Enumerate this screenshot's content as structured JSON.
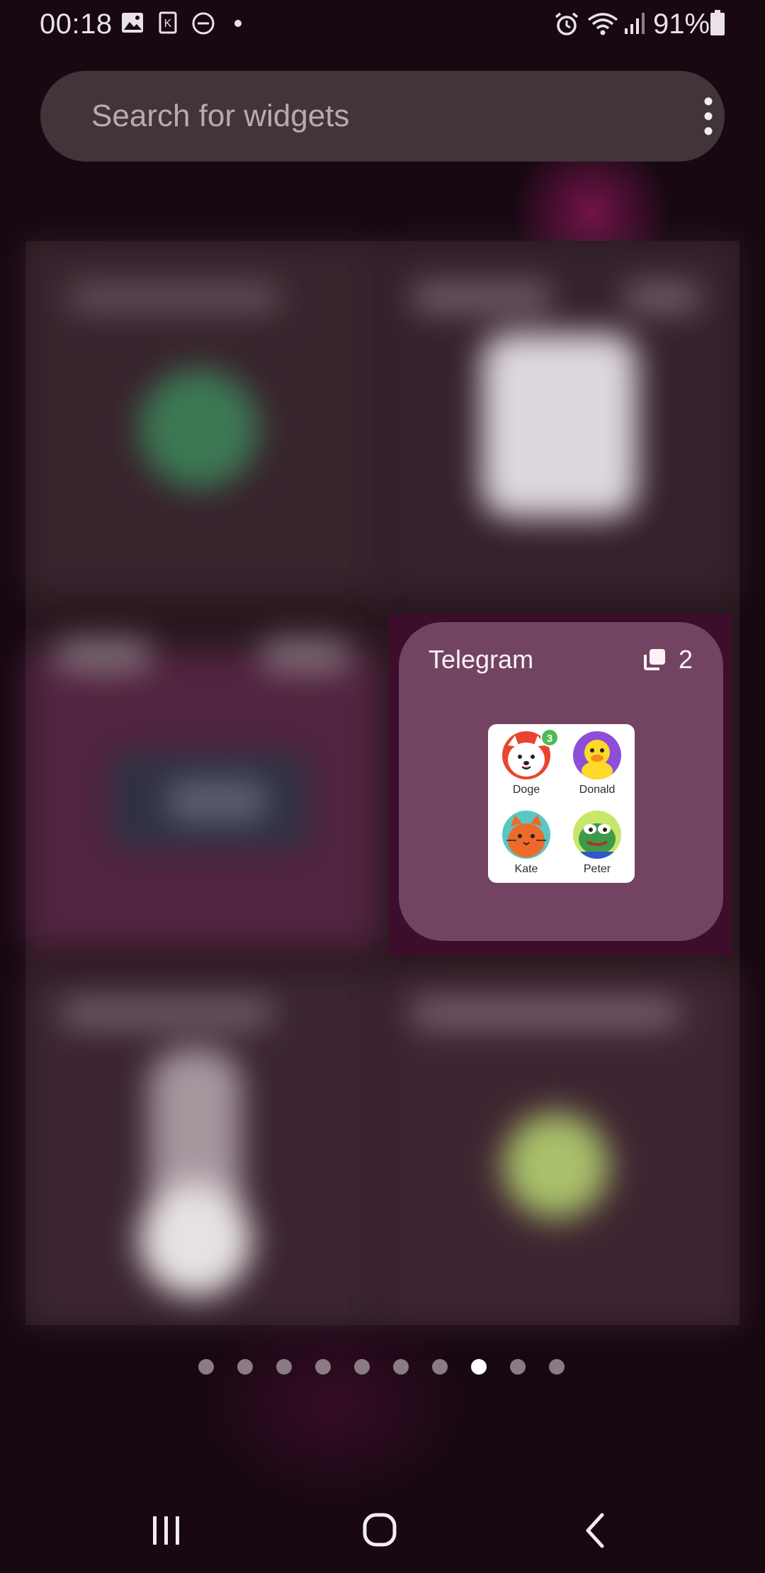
{
  "status_bar": {
    "time": "00:18",
    "battery_percent": "91%",
    "icons": [
      "image-icon",
      "k-icon",
      "do-not-disturb-icon",
      "dot-icon",
      "alarm-icon",
      "wifi-icon",
      "signal-icon",
      "battery-icon"
    ]
  },
  "search": {
    "placeholder": "Search for widgets",
    "menu_icon": "more-vertical-icon"
  },
  "telegram_widget": {
    "title": "Telegram",
    "count": "2",
    "count_icon": "widget-stack-icon",
    "contacts": [
      {
        "name": "Doge",
        "badge": "3",
        "avatar": "doge-avatar"
      },
      {
        "name": "Donald",
        "badge": "",
        "avatar": "duck-avatar"
      },
      {
        "name": "Kate",
        "badge": "",
        "avatar": "cat-avatar"
      },
      {
        "name": "Peter",
        "badge": "",
        "avatar": "frog-avatar"
      }
    ]
  },
  "pager": {
    "total": 10,
    "active_index": 7
  },
  "nav": {
    "recent": "recent-apps-icon",
    "home": "home-icon",
    "back": "back-icon"
  },
  "colors": {
    "background": "#170812",
    "search_bg": "#413539",
    "widget_card": "#734461",
    "badge": "#4dbb56"
  }
}
